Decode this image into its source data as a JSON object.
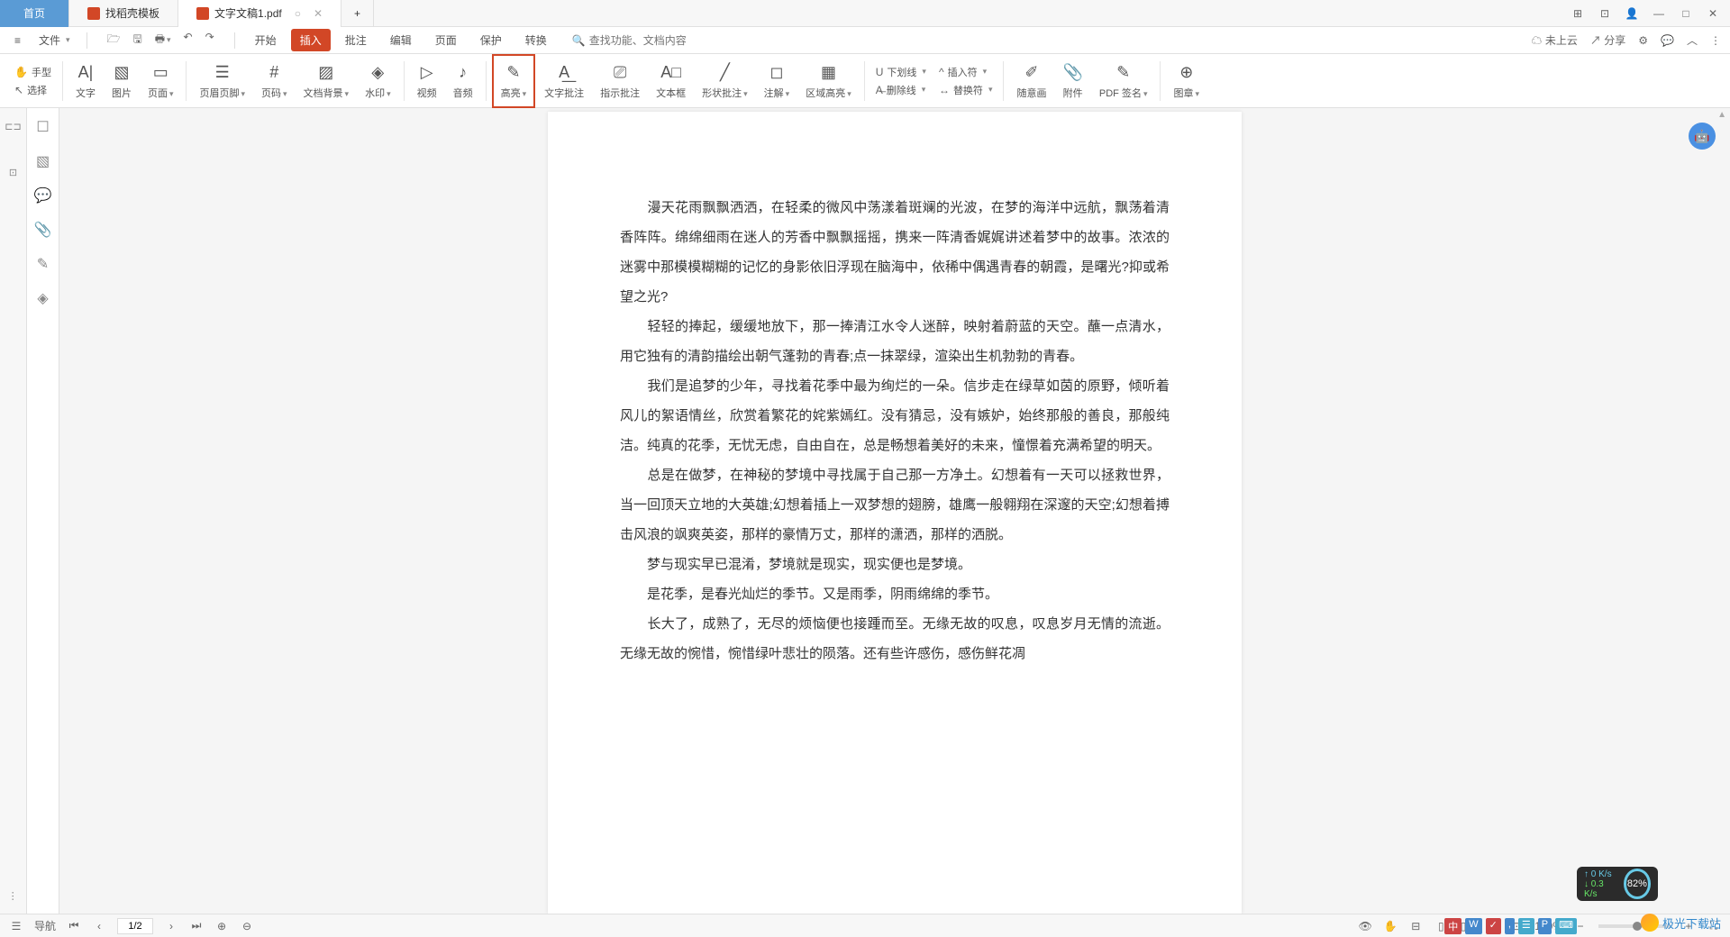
{
  "title_tabs": {
    "home": "首页",
    "tab1": "找稻壳模板",
    "tab2": "文字文稿1.pdf"
  },
  "window_controls": {
    "min": "—",
    "max": "□",
    "close": "✕"
  },
  "file_menu": "文件",
  "main_tabs": [
    "开始",
    "插入",
    "批注",
    "编辑",
    "页面",
    "保护",
    "转换"
  ],
  "search": {
    "placeholder": "查找功能、文档内容",
    "icon": "🔍"
  },
  "right_tools": {
    "cloud": "未上云",
    "share": "分享"
  },
  "ribbon_small": {
    "hand": "手型",
    "select": "选择"
  },
  "ribbon": [
    {
      "label": "文字",
      "icon": "A|"
    },
    {
      "label": "图片",
      "icon": "▧"
    },
    {
      "label": "页面",
      "icon": "▭",
      "dd": true
    },
    {
      "label": "页眉页脚",
      "icon": "☰",
      "dd": true
    },
    {
      "label": "页码",
      "icon": "#",
      "dd": true
    },
    {
      "label": "文档背景",
      "icon": "▨",
      "dd": true
    },
    {
      "label": "水印",
      "icon": "◈",
      "dd": true
    },
    {
      "label": "视频",
      "icon": "▷"
    },
    {
      "label": "音频",
      "icon": "♪"
    },
    {
      "label": "高亮",
      "icon": "✎",
      "dd": true,
      "highlighted": true
    },
    {
      "label": "文字批注",
      "icon": "A͟"
    },
    {
      "label": "指示批注",
      "icon": "⎚"
    },
    {
      "label": "文本框",
      "icon": "A□"
    },
    {
      "label": "形状批注",
      "icon": "╱",
      "dd": true
    },
    {
      "label": "注解",
      "icon": "◻",
      "dd": true
    },
    {
      "label": "区域高亮",
      "icon": "▦",
      "dd": true
    }
  ],
  "ribbon_stack1": [
    {
      "label": "下划线",
      "icon": "U"
    },
    {
      "label": "删除线",
      "icon": "A̶"
    }
  ],
  "ribbon_stack2": [
    {
      "label": "插入符",
      "icon": "^"
    },
    {
      "label": "替换符",
      "icon": "↔"
    }
  ],
  "ribbon_tail": [
    {
      "label": "随意画",
      "icon": "✐"
    },
    {
      "label": "附件",
      "icon": "📎"
    },
    {
      "label": "PDF 签名",
      "icon": "✎",
      "dd": true
    },
    {
      "label": "图章",
      "icon": "⊕",
      "dd": true
    }
  ],
  "left_rail": {
    "nav_hint": "导"
  },
  "left_icons": [
    "☐",
    "▧",
    "💬",
    "📎",
    "✎",
    "◈"
  ],
  "document": {
    "p1": "　　漫天花雨飘飘洒洒，在轻柔的微风中荡漾着斑斓的光波，在梦的海洋中远航，飘荡着清香阵阵。绵绵细雨在迷人的芳香中飘飘摇摇，携来一阵清香娓娓讲述着梦中的故事。浓浓的迷雾中那模模糊糊的记忆的身影依旧浮现在脑海中，依稀中偶遇青春的朝霞，是曙光?抑或希望之光?",
    "p2": "　　轻轻的捧起，缓缓地放下，那一捧清江水令人迷醉，映射着蔚蓝的天空。蘸一点清水，用它独有的清韵描绘出朝气蓬勃的青春;点一抹翠绿，渲染出生机勃勃的青春。",
    "p3": "　　我们是追梦的少年，寻找着花季中最为绚烂的一朵。信步走在绿草如茵的原野，倾听着风儿的絮语情丝，欣赏着繁花的姹紫嫣红。没有猜忌，没有嫉妒，始终那般的善良，那般纯洁。纯真的花季，无忧无虑，自由自在，总是畅想着美好的未来，憧憬着充满希望的明天。",
    "p4": "　　总是在做梦，在神秘的梦境中寻找属于自己那一方净土。幻想着有一天可以拯救世界，当一回顶天立地的大英雄;幻想着插上一双梦想的翅膀，雄鹰一般翱翔在深邃的天空;幻想着搏击风浪的飒爽英姿，那样的豪情万丈，那样的潇洒，那样的洒脱。",
    "p5": "　　梦与现实早已混淆，梦境就是现实，现实便也是梦境。",
    "p6": "　　是花季，是春光灿烂的季节。又是雨季，阴雨绵绵的季节。",
    "p7": "　　长大了，成熟了，无尽的烦恼便也接踵而至。无缘无故的叹息，叹息岁月无情的流逝。无缘无故的惋惜，惋惜绿叶悲壮的陨落。还有些许感伤，感伤鲜花凋"
  },
  "status": {
    "nav": "导航",
    "page": "1/2",
    "zoom": "100%"
  },
  "perf": {
    "up": "0 K/s",
    "down": "0.3 K/s",
    "pct": "82%"
  },
  "watermark": "极光下载站",
  "ime": [
    "中",
    "W",
    "✓",
    ",",
    "☰",
    "P",
    "⌨"
  ]
}
